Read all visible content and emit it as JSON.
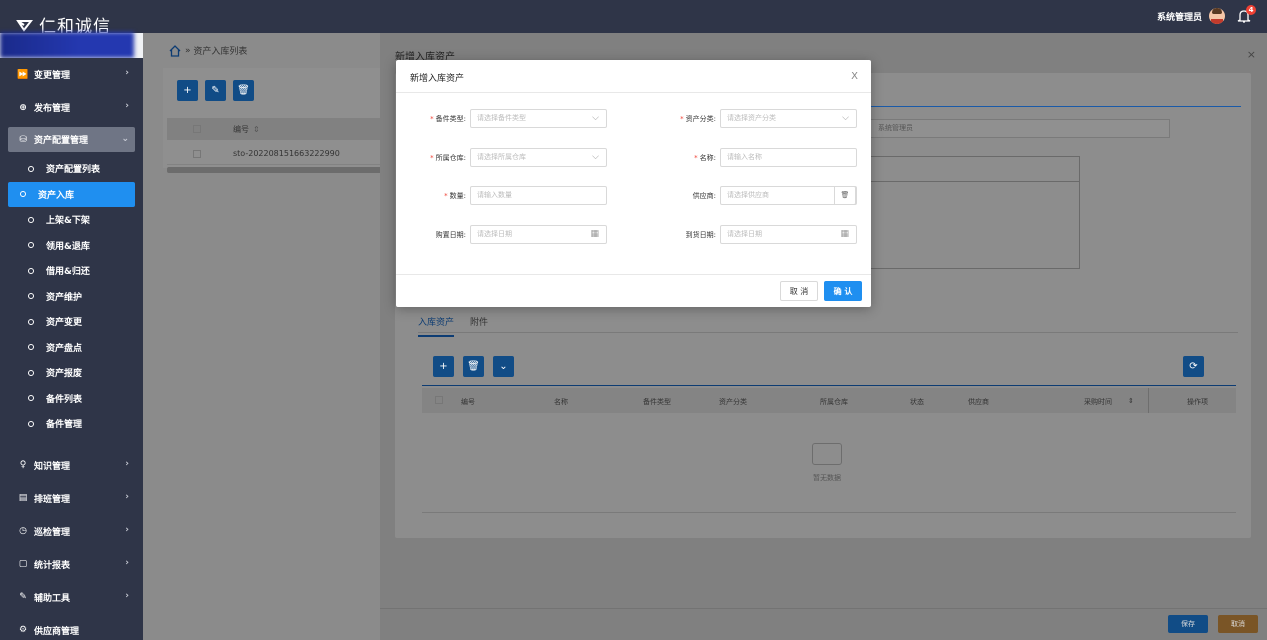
{
  "app": {
    "logo_text": "仁和诚信"
  },
  "topbar": {
    "user_name": "系统管理员",
    "notification_count": "4"
  },
  "sidebar": {
    "items": [
      {
        "label": "变更管理",
        "icon": "fast-forward-icon"
      },
      {
        "label": "发布管理",
        "icon": "globe-icon"
      },
      {
        "label": "资产配置管理",
        "icon": "database-icon"
      }
    ],
    "sub_items": [
      {
        "label": "资产配置列表"
      },
      {
        "label": "资产入库"
      },
      {
        "label": "上架&下架"
      },
      {
        "label": "领用&退库"
      },
      {
        "label": "借用&归还"
      },
      {
        "label": "资产维护"
      },
      {
        "label": "资产变更"
      },
      {
        "label": "资产盘点"
      },
      {
        "label": "资产报废"
      },
      {
        "label": "备件列表"
      },
      {
        "label": "备件管理"
      }
    ],
    "bottom_items": [
      {
        "label": "知识管理",
        "icon": "bulb-icon"
      },
      {
        "label": "排班管理",
        "icon": "calendar-icon"
      },
      {
        "label": "巡检管理",
        "icon": "clock-icon"
      },
      {
        "label": "统计报表",
        "icon": "report-icon"
      },
      {
        "label": "辅助工具",
        "icon": "tool-icon"
      },
      {
        "label": "供应商管理",
        "icon": "supplier-icon"
      }
    ]
  },
  "page": {
    "breadcrumb": "资产入库列表",
    "table": {
      "col_no": "编号",
      "row_no": "sto-202208151663222990"
    }
  },
  "drawer": {
    "title": "新增入库资产",
    "close": "×",
    "input_value": "系统管理员",
    "tabs": [
      "入库资产",
      "附件"
    ],
    "columns": [
      "编号",
      "名称",
      "备件类型",
      "资产分类",
      "所属仓库",
      "状态",
      "供应商",
      "采购时间",
      "操作项"
    ],
    "empty_text": "暂无数据",
    "save_label": "保存",
    "cancel_label": "取消"
  },
  "modal": {
    "title": "新增入库资产",
    "close": "X",
    "fields": {
      "spare_type": {
        "label": "备件类型:",
        "placeholder": "请选择备件类型"
      },
      "asset_category": {
        "label": "资产分类:",
        "placeholder": "请选择资产分类"
      },
      "warehouse": {
        "label": "所属仓库:",
        "placeholder": "请选择所属仓库"
      },
      "name": {
        "label": "名称:",
        "placeholder": "请输入名称"
      },
      "quantity": {
        "label": "数量:",
        "placeholder": "请输入数量"
      },
      "supplier": {
        "label": "供应商:",
        "placeholder": "请选择供应商"
      },
      "purchase_date": {
        "label": "购置日期:",
        "placeholder": "请选择日期"
      },
      "arrival_date": {
        "label": "到货日期:",
        "placeholder": "请选择日期"
      }
    },
    "cancel_label": "取 消",
    "ok_label": "确 认"
  },
  "colors": {
    "sidebar_bg": "#2f3548",
    "primary": "#1f8ff0",
    "dark_primary": "#114c86",
    "warning": "#c77c1e",
    "danger": "#f04134"
  }
}
